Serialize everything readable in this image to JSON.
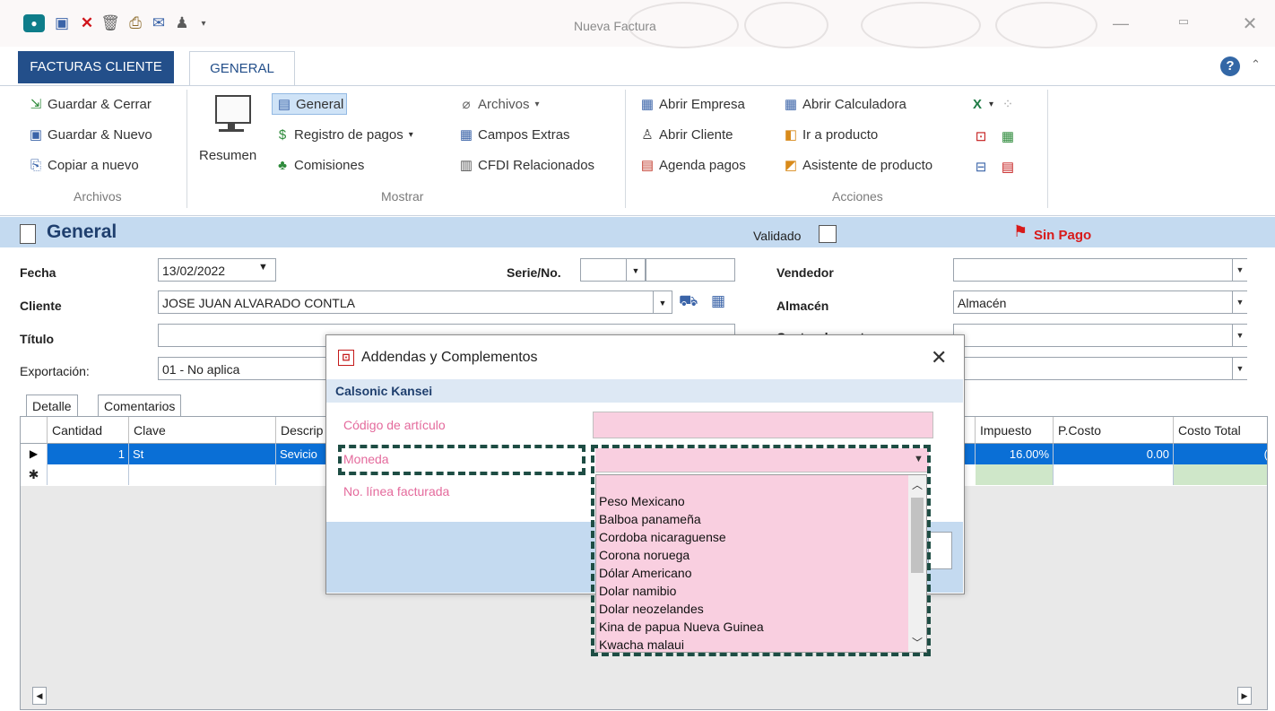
{
  "window": {
    "title": "Nueva Factura"
  },
  "ribbon_tabs": {
    "file": "FACTURAS CLIENTE",
    "general": "GENERAL"
  },
  "ribbon": {
    "archivos": {
      "guardar_cerrar": "Guardar & Cerrar",
      "guardar_nuevo": "Guardar & Nuevo",
      "copiar_nuevo": "Copiar a nuevo",
      "label": "Archivos"
    },
    "mostrar": {
      "resumen": "Resumen",
      "general": "General",
      "registro_pagos": "Registro de pagos",
      "comisiones": "Comisiones",
      "archivos": "Archivos",
      "campos_extras": "Campos Extras",
      "cfdi": "CFDI Relacionados",
      "label": "Mostrar"
    },
    "acciones": {
      "abrir_empresa": "Abrir Empresa",
      "abrir_cliente": "Abrir Cliente",
      "agenda_pagos": "Agenda pagos",
      "abrir_calculadora": "Abrir Calculadora",
      "ir_producto": "Ir a producto",
      "asistente_producto": "Asistente de producto",
      "label": "Acciones"
    }
  },
  "section": {
    "title": "General",
    "validado": "Validado",
    "status": "Sin Pago"
  },
  "form": {
    "fecha_label": "Fecha",
    "fecha_value": "13/02/2022",
    "serie_label": "Serie/No.",
    "vendedor_label": "Vendedor",
    "cliente_label": "Cliente",
    "cliente_value": "JOSE JUAN ALVARADO CONTLA",
    "almacen_label": "Almacén",
    "almacen_value": "Almacén",
    "titulo_label": "Título",
    "centro_label": "Centro de costo",
    "exportacion_label": "Exportación:",
    "exportacion_value": "01 - No aplica"
  },
  "grid": {
    "tabs": [
      "Detalle",
      "Comentarios"
    ],
    "headers": {
      "cantidad": "Cantidad",
      "clave": "Clave",
      "descripcion": "Descrip",
      "descuento": "o",
      "impuesto": "Impuesto",
      "pcosto": "P.Costo",
      "costo_total": "Costo Total"
    },
    "row": {
      "cantidad": "1",
      "clave": "St",
      "descripcion": "Sevicio",
      "impuesto": "16.00%",
      "pcosto": "0.00",
      "costo_total": "("
    }
  },
  "dialog": {
    "title": "Addendas y Complementos",
    "subtitle": "Calsonic Kansei",
    "codigo_label": "Código de artículo",
    "moneda_label": "Moneda",
    "linea_label": "No. línea facturada",
    "moneda_value": "",
    "options": [
      "Peso Mexicano",
      "Balboa panameña",
      "Cordoba nicaraguense",
      "Corona noruega",
      "Dólar Americano",
      "Dolar namibio",
      "Dolar neozelandes",
      "Kina de papua Nueva Guinea",
      "Kwacha malaui"
    ]
  },
  "colors": {
    "accent": "#234f8a",
    "section_bar": "#c4daf0",
    "selected_row": "#0a6fd6",
    "pink_field": "#f9cfe0",
    "highlight": "#1e4d44",
    "status_red": "#d81a1a"
  }
}
